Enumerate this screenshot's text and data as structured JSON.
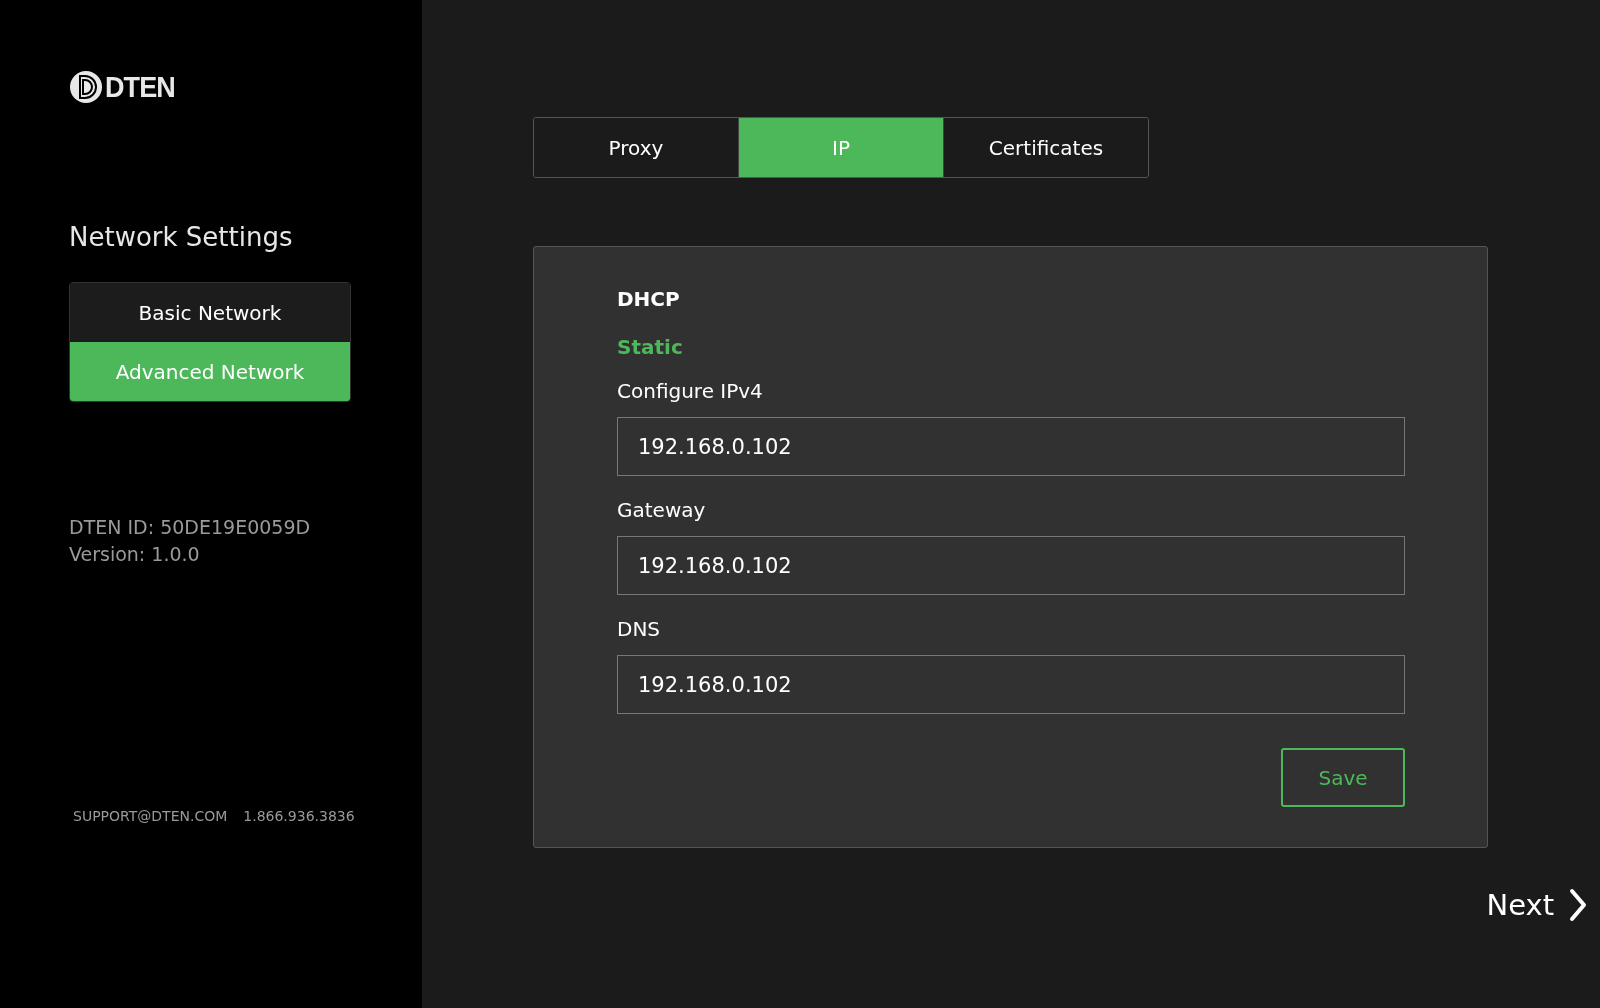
{
  "sidebar": {
    "logo": "DTEN",
    "title": "Network Settings",
    "menu": [
      {
        "label": "Basic Network",
        "selected": false
      },
      {
        "label": "Advanced Network",
        "selected": true
      }
    ],
    "device_id": "DTEN ID: 50DE19E0059D",
    "version": "Version: 1.0.0",
    "support_email": "SUPPORT@DTEN.COM",
    "support_phone": "1.866.936.3836"
  },
  "tabs": [
    {
      "label": "Proxy",
      "selected": false
    },
    {
      "label": "IP",
      "selected": true
    },
    {
      "label": "Certificates",
      "selected": false
    }
  ],
  "panel": {
    "modes": [
      {
        "label": "DHCP",
        "selected": false
      },
      {
        "label": "Static",
        "selected": true
      }
    ],
    "fields": [
      {
        "label": "Configure IPv4",
        "value": "192.168.0.102"
      },
      {
        "label": "Gateway",
        "value": "192.168.0.102"
      },
      {
        "label": "DNS",
        "value": "192.168.0.102"
      }
    ],
    "save": "Save"
  },
  "next": "Next"
}
